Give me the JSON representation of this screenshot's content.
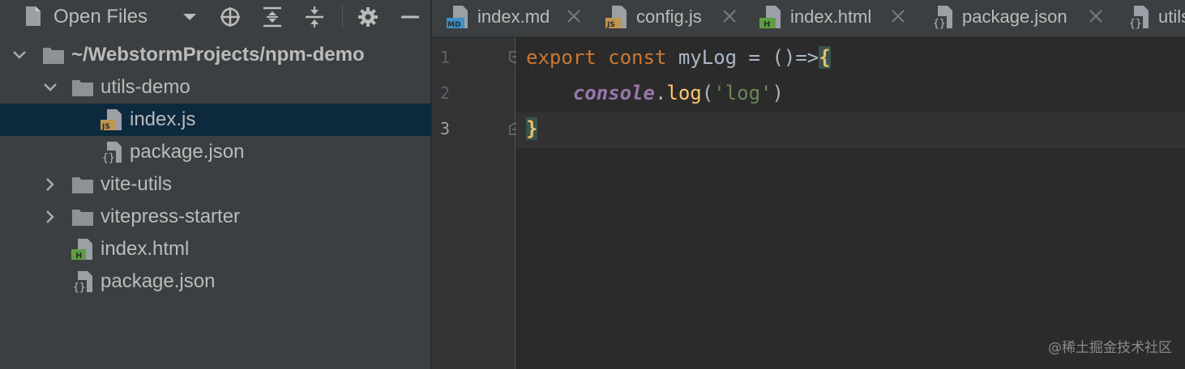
{
  "project_panel": {
    "title": "Open Files",
    "tree": [
      {
        "label": "~/WebstormProjects/npm-demo",
        "type": "folder",
        "expanded": true,
        "bold": true
      },
      {
        "label": "utils-demo",
        "type": "folder",
        "expanded": true
      },
      {
        "label": "index.js",
        "type": "js",
        "selected": true
      },
      {
        "label": "package.json",
        "type": "json"
      },
      {
        "label": "vite-utils",
        "type": "folder",
        "expanded": false
      },
      {
        "label": "vitepress-starter",
        "type": "folder",
        "expanded": false
      },
      {
        "label": "index.html",
        "type": "html"
      },
      {
        "label": "package.json",
        "type": "json"
      }
    ]
  },
  "tabs": [
    {
      "label": "index.md",
      "icon": "markdown-file-icon",
      "badge": "MD"
    },
    {
      "label": "config.js",
      "icon": "js-file-icon",
      "badge": "JS"
    },
    {
      "label": "index.html",
      "icon": "html-file-icon",
      "badge": "H"
    },
    {
      "label": "package.json",
      "icon": "json-file-icon",
      "badge": "{}"
    },
    {
      "label": "utils",
      "icon": "json-file-icon",
      "badge": "{}"
    }
  ],
  "editor": {
    "line_numbers": [
      "1",
      "2",
      "3"
    ],
    "current_line": 3,
    "code": {
      "l1": {
        "kw1": "export",
        "kw2": "const",
        "name": "myLog",
        "op": " = ()=>",
        "brace": "{"
      },
      "l2": {
        "indent": "    ",
        "obj": "console",
        "dot": ".",
        "method": "log",
        "open": "(",
        "str": "'log'",
        "close": ")"
      },
      "l3": {
        "brace": "}"
      }
    }
  },
  "watermark": "@稀土掘金技术社区",
  "colors": {
    "panel_bg": "#3c3f41",
    "editor_bg": "#2b2b2b",
    "selection": "#0d293e",
    "keyword": "#cc7832",
    "string": "#6a8759",
    "global": "#9876aa",
    "method": "#ffc66d"
  }
}
